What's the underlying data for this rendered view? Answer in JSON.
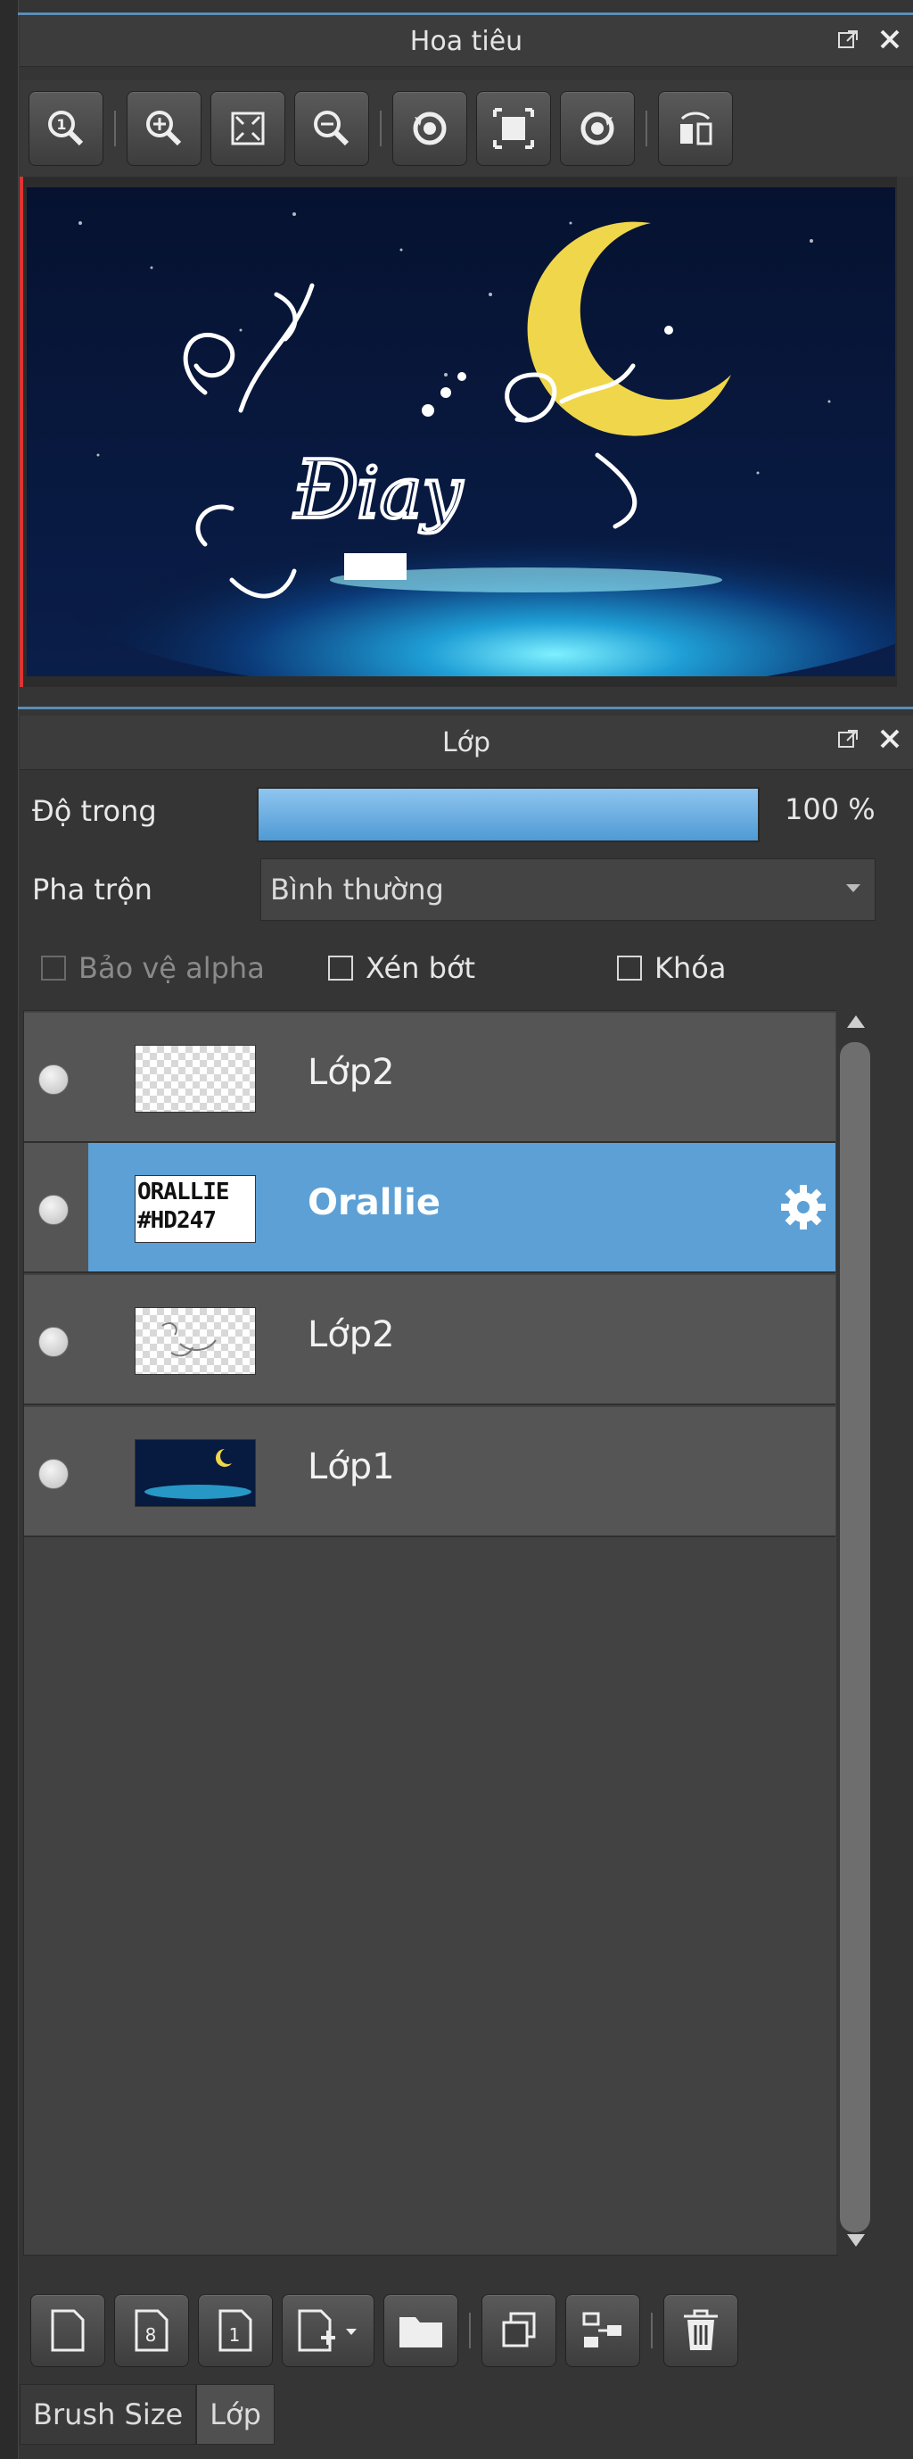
{
  "navigator": {
    "title": "Hoa tiêu",
    "toolbar_icons": [
      "zoom-actual-icon",
      "zoom-in-icon",
      "fit-window-icon",
      "zoom-out-icon",
      "rotate-left-icon",
      "fit-view-icon",
      "rotate-right-icon",
      "flip-horizontal-icon"
    ]
  },
  "layers_panel": {
    "title": "Lớp",
    "opacity": {
      "label": "Độ trong",
      "value": "100 %",
      "fraction": 1.0
    },
    "blend": {
      "label": "Pha trộn",
      "value": "Bình thường"
    },
    "options": {
      "protect_alpha": "Bảo vệ alpha",
      "clipping": "Xén bớt",
      "lock": "Khóa"
    },
    "layers": [
      {
        "name": "Lớp2",
        "selected": false,
        "thumb": "transparent"
      },
      {
        "name": "Orallie",
        "selected": true,
        "thumb": "text",
        "thumb_text_1": "ORALLIE",
        "thumb_text_2": "#HD247"
      },
      {
        "name": "Lớp2",
        "selected": false,
        "thumb": "sketch"
      },
      {
        "name": "Lớp1",
        "selected": false,
        "thumb": "night"
      }
    ]
  },
  "bottom_toolbar_icons": [
    "new-layer-icon",
    "new-8bit-layer-icon",
    "new-1bit-layer-icon",
    "add-layer-menu-icon",
    "folder-icon",
    "duplicate-layer-icon",
    "merge-layer-icon",
    "delete-layer-icon"
  ],
  "tabs": [
    {
      "label": "Brush Size",
      "active": false
    },
    {
      "label": "Lớp",
      "active": true
    }
  ],
  "colors": {
    "accent": "#5b8db8",
    "selected_layer": "#5da0d6",
    "panel_bg": "#353535"
  }
}
